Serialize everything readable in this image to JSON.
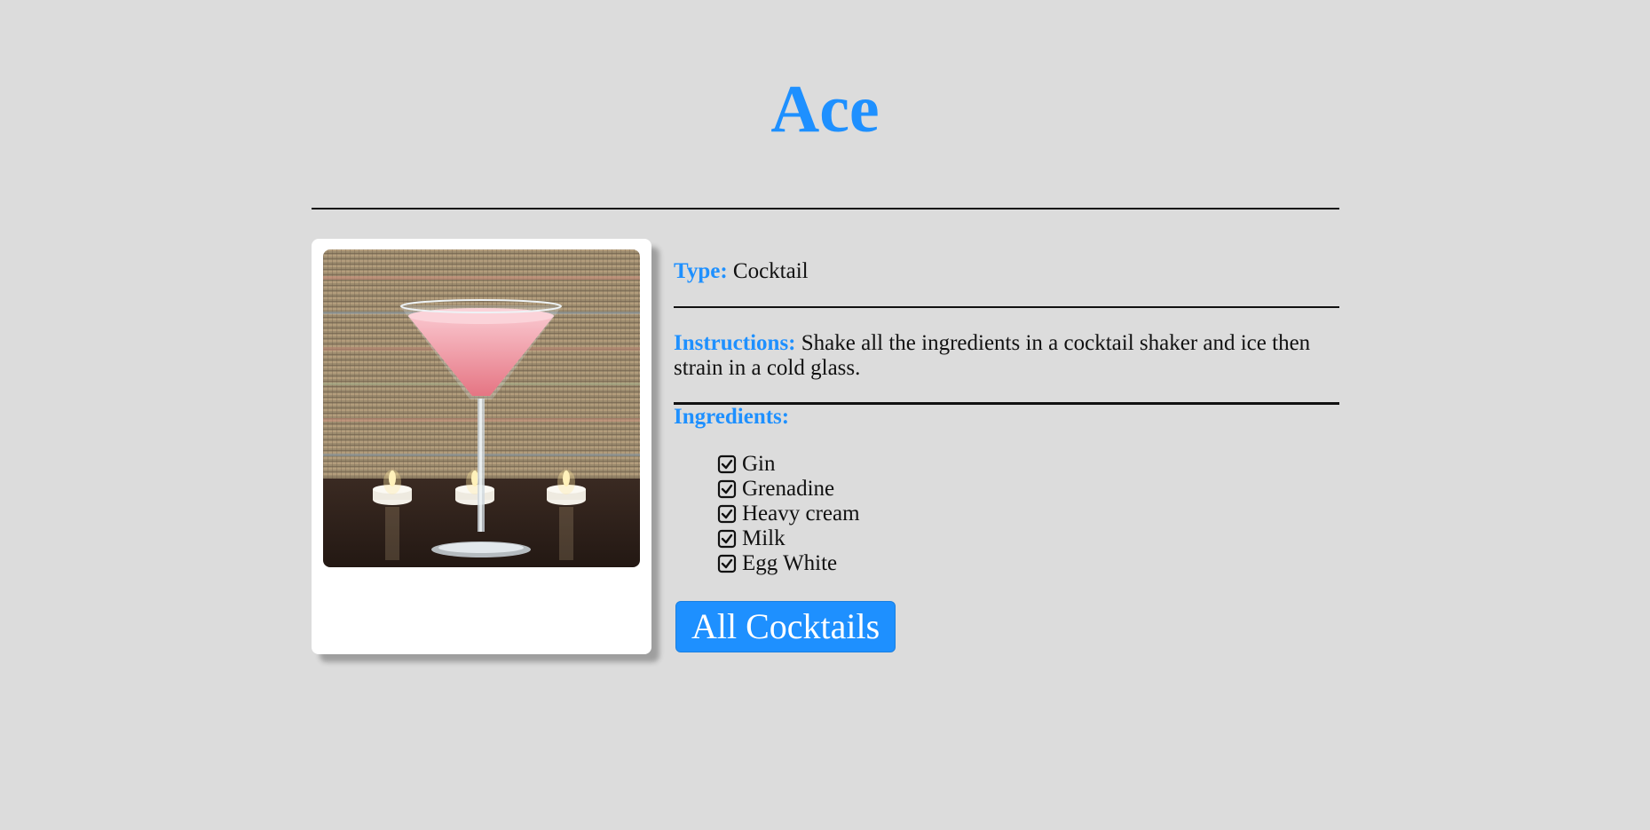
{
  "title": "Ace",
  "image": {
    "alt": "Ace cocktail"
  },
  "type": {
    "label": "Type:",
    "value": "Cocktail"
  },
  "instructions": {
    "label": "Instructions:",
    "value": "Shake all the ingredients in a cocktail shaker and ice then strain in a cold glass."
  },
  "ingredients": {
    "label": "Ingredients:",
    "items": [
      "Gin",
      "Grenadine",
      "Heavy cream",
      "Milk",
      "Egg White"
    ],
    "icon": "checkbox-checked-icon"
  },
  "button": {
    "label": "All Cocktails"
  },
  "colors": {
    "accent": "#1e90ff",
    "background": "#dcdcdc",
    "card": "#ffffff"
  }
}
